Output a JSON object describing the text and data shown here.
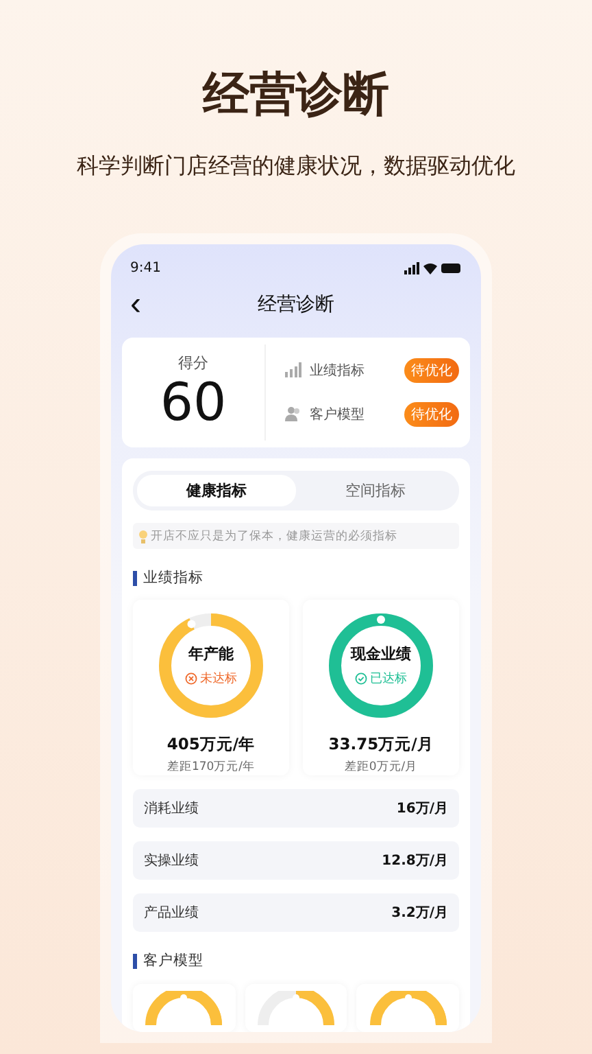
{
  "headline": "经营诊断",
  "subtitle": "科学判断门店经营的健康状况，数据驱动优化",
  "status_bar": {
    "time": "9:41"
  },
  "nav": {
    "back": "‹",
    "title": "经营诊断"
  },
  "score": {
    "label": "得分",
    "value": "60",
    "items": [
      {
        "kind": "chart",
        "label": "业绩指标",
        "badge": "待优化"
      },
      {
        "kind": "people",
        "label": "客户模型",
        "badge": "待优化"
      }
    ]
  },
  "tabs": [
    {
      "label": "健康指标",
      "selected": true
    },
    {
      "label": "空间指标",
      "selected": false
    }
  ],
  "hint": "开店不应只是为了保本，健康运营的必须指标",
  "performance": {
    "title": "业绩指标",
    "rings": [
      {
        "name": "年产能",
        "status": "未达标",
        "kind": "unmet",
        "level": 0.93,
        "color": "#fbbf3c",
        "value": "405万元/年",
        "gap": "差距170万元/年"
      },
      {
        "name": "现金业绩",
        "status": "已达标",
        "kind": "met",
        "level": 1,
        "color": "#1fbf95",
        "value": "33.75万元/月",
        "gap": "差距0万元/月"
      }
    ],
    "rows": [
      {
        "label": "消耗业绩",
        "value": "16万/月"
      },
      {
        "label": "实操业绩",
        "value": "12.8万/月"
      },
      {
        "label": "产品业绩",
        "value": "3.2万/月"
      }
    ]
  },
  "customer_model": {
    "title": "客户模型",
    "cards": [
      {
        "kind": "gauge"
      },
      {
        "kind": "gauge"
      },
      {
        "kind": "gauge"
      }
    ]
  }
}
